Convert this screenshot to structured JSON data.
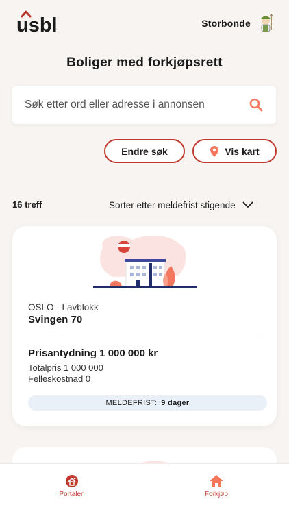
{
  "header": {
    "logo_text": "usbl",
    "user_name": "Storbonde"
  },
  "page": {
    "title": "Boliger med forkjøpsrett"
  },
  "search": {
    "placeholder": "Søk etter ord eller adresse i annonsen",
    "value": ""
  },
  "actions": {
    "edit_search": "Endre søk",
    "show_map": "Vis kart"
  },
  "results": {
    "count_label": "16 treff",
    "sort_label": "Sorter etter meldefrist stigende"
  },
  "listings": [
    {
      "location": "OSLO - Lavblokk",
      "address": "Svingen 70",
      "price_label": "Prisantydning 1 000 000 kr",
      "total_label": "Totalpris 1 000 000",
      "common_cost_label": "Felleskostnad 0",
      "deadline_key": "MELDEFRIST:",
      "deadline_value": "9 dager"
    }
  ],
  "tabbar": {
    "portal": "Portalen",
    "buy": "Forkjøp"
  },
  "colors": {
    "accent": "#c0392f",
    "background": "#f7f4f1",
    "card": "#ffffff",
    "deadline_bg": "#e9f0f8",
    "illustration_pink": "#fbe3e1",
    "illustration_orange": "#f2785f"
  },
  "icons": {
    "search": "search-icon",
    "map_pin": "map-pin-icon",
    "sort": "chevron-down-icon",
    "portal": "portal-icon",
    "buy": "home-icon"
  }
}
